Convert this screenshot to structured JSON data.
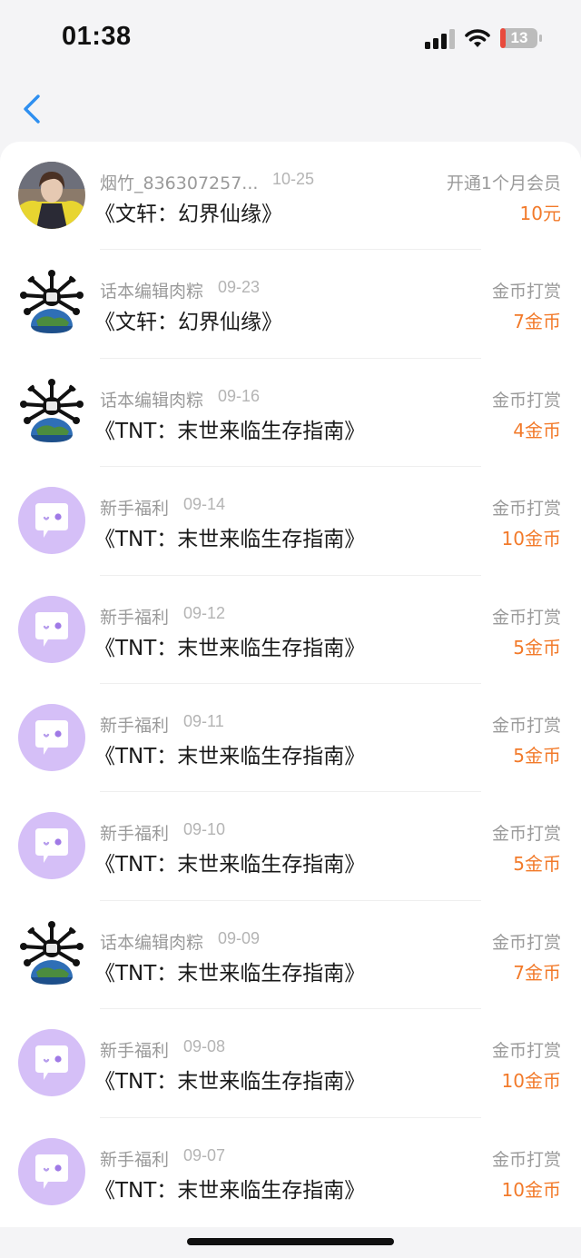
{
  "status_bar": {
    "time": "01:38",
    "battery": "13"
  },
  "colors": {
    "accent": "#2e8ff0",
    "amount": "#f27a2a",
    "bubble": "#d5bff7"
  },
  "records": [
    {
      "avatar": "photo-avatar",
      "name": "烟竹_836307257...",
      "date": "10-25",
      "title": "《文轩：幻界仙缘》",
      "type": "开通1个月会员",
      "amount": "10元"
    },
    {
      "avatar": "globe-avatar",
      "name": "话本编辑肉粽",
      "date": "09-23",
      "title": "《文轩：幻界仙缘》",
      "type": "金币打赏",
      "amount": "7金币"
    },
    {
      "avatar": "globe-avatar",
      "name": "话本编辑肉粽",
      "date": "09-16",
      "title": "《TNT：末世来临生存指南》",
      "type": "金币打赏",
      "amount": "4金币"
    },
    {
      "avatar": "bubble-avatar",
      "name": "新手福利",
      "date": "09-14",
      "title": "《TNT：末世来临生存指南》",
      "type": "金币打赏",
      "amount": "10金币"
    },
    {
      "avatar": "bubble-avatar",
      "name": "新手福利",
      "date": "09-12",
      "title": "《TNT：末世来临生存指南》",
      "type": "金币打赏",
      "amount": "5金币"
    },
    {
      "avatar": "bubble-avatar",
      "name": "新手福利",
      "date": "09-11",
      "title": "《TNT：末世来临生存指南》",
      "type": "金币打赏",
      "amount": "5金币"
    },
    {
      "avatar": "bubble-avatar",
      "name": "新手福利",
      "date": "09-10",
      "title": "《TNT：末世来临生存指南》",
      "type": "金币打赏",
      "amount": "5金币"
    },
    {
      "avatar": "globe-avatar",
      "name": "话本编辑肉粽",
      "date": "09-09",
      "title": "《TNT：末世来临生存指南》",
      "type": "金币打赏",
      "amount": "7金币"
    },
    {
      "avatar": "bubble-avatar",
      "name": "新手福利",
      "date": "09-08",
      "title": "《TNT：末世来临生存指南》",
      "type": "金币打赏",
      "amount": "10金币"
    },
    {
      "avatar": "bubble-avatar",
      "name": "新手福利",
      "date": "09-07",
      "title": "《TNT：末世来临生存指南》",
      "type": "金币打赏",
      "amount": "10金币"
    }
  ]
}
